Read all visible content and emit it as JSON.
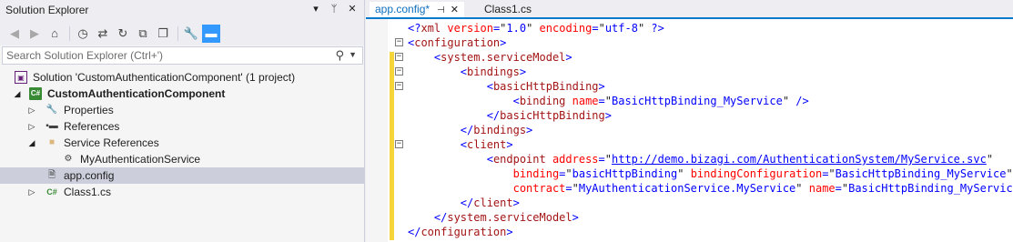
{
  "solution_explorer": {
    "title": "Solution Explorer",
    "title_buttons": [
      "▾",
      "ᛘ",
      "✕"
    ],
    "toolbar_icons": [
      "back-icon",
      "forward-icon",
      "home-icon",
      "history-icon",
      "sync-icon",
      "refresh-icon",
      "collapse-all-icon",
      "show-all-files-icon",
      "properties-icon",
      "preview-icon"
    ],
    "search_placeholder": "Search Solution Explorer (Ctrl+')",
    "tree": [
      {
        "label": "Solution 'CustomAuthenticationComponent' (1 project)",
        "icon": "solution-icon",
        "expander": ""
      },
      {
        "label": "CustomAuthenticationComponent",
        "icon": "csharp-project-icon",
        "expander": "◢"
      },
      {
        "label": "Properties",
        "icon": "wrench-icon",
        "expander": "▷"
      },
      {
        "label": "References",
        "icon": "references-icon",
        "expander": "▷"
      },
      {
        "label": "Service References",
        "icon": "folder-icon",
        "expander": "◢"
      },
      {
        "label": "MyAuthenticationService",
        "icon": "service-reference-icon",
        "expander": ""
      },
      {
        "label": "app.config",
        "icon": "config-file-icon",
        "expander": ""
      },
      {
        "label": "Class1.cs",
        "icon": "csharp-file-icon",
        "expander": "▷"
      }
    ]
  },
  "editor": {
    "tabs": [
      {
        "label": "app.config*",
        "pin": "⊣",
        "close": "✕"
      },
      {
        "label": "Class1.cs"
      }
    ],
    "lines": [
      {
        "fold": "",
        "indent": 0,
        "parts": [
          {
            "t": "<?",
            "c": "b"
          },
          {
            "t": "xml",
            "c": "m"
          },
          {
            "t": " version",
            "c": "a"
          },
          {
            "t": "=",
            "c": "b"
          },
          {
            "t": "\"",
            "c": ""
          },
          {
            "t": "1.0",
            "c": "v"
          },
          {
            "t": "\"",
            "c": ""
          },
          {
            "t": " encoding",
            "c": "a"
          },
          {
            "t": "=",
            "c": "b"
          },
          {
            "t": "\"",
            "c": ""
          },
          {
            "t": "utf-8",
            "c": "v"
          },
          {
            "t": "\"",
            "c": ""
          },
          {
            "t": " ?>",
            "c": "b"
          }
        ]
      },
      {
        "fold": "−",
        "indent": 0,
        "parts": [
          {
            "t": "<",
            "c": "b"
          },
          {
            "t": "configuration",
            "c": "m"
          },
          {
            "t": ">",
            "c": "b"
          }
        ]
      },
      {
        "fold": "−",
        "indent": 1,
        "parts": [
          {
            "t": "<",
            "c": "b"
          },
          {
            "t": "system.serviceModel",
            "c": "m"
          },
          {
            "t": ">",
            "c": "b"
          }
        ]
      },
      {
        "fold": "−",
        "indent": 2,
        "parts": [
          {
            "t": "<",
            "c": "b"
          },
          {
            "t": "bindings",
            "c": "m"
          },
          {
            "t": ">",
            "c": "b"
          }
        ]
      },
      {
        "fold": "−",
        "indent": 3,
        "parts": [
          {
            "t": "<",
            "c": "b"
          },
          {
            "t": "basicHttpBinding",
            "c": "m"
          },
          {
            "t": ">",
            "c": "b"
          }
        ]
      },
      {
        "fold": "",
        "indent": 4,
        "parts": [
          {
            "t": "<",
            "c": "b"
          },
          {
            "t": "binding",
            "c": "m"
          },
          {
            "t": " name",
            "c": "a"
          },
          {
            "t": "=",
            "c": "b"
          },
          {
            "t": "\"",
            "c": ""
          },
          {
            "t": "BasicHttpBinding_MyService",
            "c": "v"
          },
          {
            "t": "\"",
            "c": ""
          },
          {
            "t": " />",
            "c": "b"
          }
        ]
      },
      {
        "fold": "",
        "indent": 3,
        "parts": [
          {
            "t": "</",
            "c": "b"
          },
          {
            "t": "basicHttpBinding",
            "c": "m"
          },
          {
            "t": ">",
            "c": "b"
          }
        ]
      },
      {
        "fold": "",
        "indent": 2,
        "parts": [
          {
            "t": "</",
            "c": "b"
          },
          {
            "t": "bindings",
            "c": "m"
          },
          {
            "t": ">",
            "c": "b"
          }
        ]
      },
      {
        "fold": "−",
        "indent": 2,
        "parts": [
          {
            "t": "<",
            "c": "b"
          },
          {
            "t": "client",
            "c": "m"
          },
          {
            "t": ">",
            "c": "b"
          }
        ]
      },
      {
        "fold": "",
        "indent": 3,
        "parts": [
          {
            "t": "<",
            "c": "b"
          },
          {
            "t": "endpoint",
            "c": "m"
          },
          {
            "t": " address",
            "c": "a"
          },
          {
            "t": "=",
            "c": "b"
          },
          {
            "t": "\"",
            "c": ""
          },
          {
            "t": "http://demo.bizagi.com/AuthenticationSystem/MyService.svc",
            "c": "u"
          },
          {
            "t": "\"",
            "c": ""
          }
        ]
      },
      {
        "fold": "",
        "indent": 3,
        "pad": "    ",
        "parts": [
          {
            "t": "binding",
            "c": "a"
          },
          {
            "t": "=",
            "c": "b"
          },
          {
            "t": "\"",
            "c": ""
          },
          {
            "t": "basicHttpBinding",
            "c": "v"
          },
          {
            "t": "\"",
            "c": ""
          },
          {
            "t": " bindingConfiguration",
            "c": "a"
          },
          {
            "t": "=",
            "c": "b"
          },
          {
            "t": "\"",
            "c": ""
          },
          {
            "t": "BasicHttpBinding_MyService",
            "c": "v"
          },
          {
            "t": "\"",
            "c": ""
          }
        ]
      },
      {
        "fold": "",
        "indent": 3,
        "pad": "    ",
        "parts": [
          {
            "t": "contract",
            "c": "a"
          },
          {
            "t": "=",
            "c": "b"
          },
          {
            "t": "\"",
            "c": ""
          },
          {
            "t": "MyAuthenticationService.MyService",
            "c": "v"
          },
          {
            "t": "\"",
            "c": ""
          },
          {
            "t": " name",
            "c": "a"
          },
          {
            "t": "=",
            "c": "b"
          },
          {
            "t": "\"",
            "c": ""
          },
          {
            "t": "BasicHttpBinding_MyService",
            "c": "v"
          },
          {
            "t": "\"",
            "c": ""
          },
          {
            "t": " />",
            "c": "b"
          }
        ]
      },
      {
        "fold": "",
        "indent": 2,
        "parts": [
          {
            "t": "</",
            "c": "b"
          },
          {
            "t": "client",
            "c": "m"
          },
          {
            "t": ">",
            "c": "b"
          }
        ]
      },
      {
        "fold": "",
        "indent": 1,
        "parts": [
          {
            "t": "</",
            "c": "b"
          },
          {
            "t": "system.serviceModel",
            "c": "m"
          },
          {
            "t": ">",
            "c": "b"
          }
        ]
      },
      {
        "fold": "",
        "indent": 0,
        "parts": [
          {
            "t": "</",
            "c": "b"
          },
          {
            "t": "configuration",
            "c": "m"
          },
          {
            "t": ">",
            "c": "b"
          }
        ]
      }
    ]
  },
  "colors": {
    "accent": "#007acc",
    "selection": "#cccedb",
    "change_bar": "#f6d53b",
    "xml_delimiter": "#0000ff",
    "xml_name": "#a31515",
    "xml_attribute": "#ff0000"
  }
}
